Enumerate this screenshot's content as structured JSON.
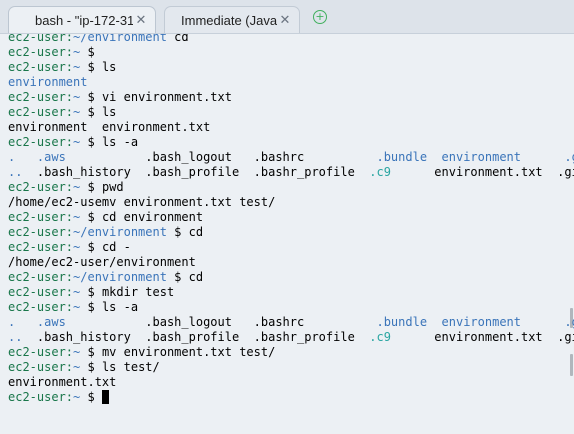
{
  "tabs": [
    {
      "label": "bash - \"ip-172-31",
      "close": "✕"
    },
    {
      "label": "Immediate (Javas",
      "close": "✕"
    }
  ],
  "add_tab_icon": "plus-circle-icon",
  "terminal": {
    "prompt_user": "ec2-user:",
    "home": "~",
    "dir": "~/environment",
    "lines": [
      {
        "type": "prompt",
        "dir": "~/environment",
        "cmd": "cd"
      },
      {
        "type": "prompt",
        "dir": "~",
        "cmd": "$"
      },
      {
        "type": "prompt",
        "dir": "~",
        "cmd": "$ ls"
      },
      {
        "type": "output",
        "text": "environment"
      },
      {
        "type": "prompt",
        "dir": "~",
        "cmd": "$ vi environment.txt"
      },
      {
        "type": "prompt",
        "dir": "~",
        "cmd": "$ ls"
      },
      {
        "type": "output",
        "text": "environment  environment.txt"
      },
      {
        "type": "prompt",
        "dir": "~",
        "cmd": "$ ls -a"
      },
      {
        "type": "ls",
        "row": 1
      },
      {
        "type": "ls",
        "row": 2
      },
      {
        "type": "prompt",
        "dir": "~",
        "cmd": "$ pwd"
      },
      {
        "type": "output",
        "text": "/home/ec2-usemv environment.txt test/"
      },
      {
        "type": "prompt",
        "dir": "~",
        "cmd": "$ cd environment"
      },
      {
        "type": "prompt",
        "dir": "~/environment",
        "cmd": "$ cd"
      },
      {
        "type": "prompt",
        "dir": "~",
        "cmd": "$ cd -"
      },
      {
        "type": "output",
        "text": "/home/ec2-user/environment"
      },
      {
        "type": "prompt",
        "dir": "~/environment",
        "cmd": "$ cd"
      },
      {
        "type": "prompt",
        "dir": "~",
        "cmd": "$ mkdir test"
      },
      {
        "type": "prompt",
        "dir": "~",
        "cmd": "$ ls -a"
      },
      {
        "type": "ls",
        "row": 1
      },
      {
        "type": "ls",
        "row": 3
      },
      {
        "type": "prompt",
        "dir": "~",
        "cmd": "$ mv environment.txt test/"
      },
      {
        "type": "prompt",
        "dir": "~",
        "cmd": "$ ls test/"
      },
      {
        "type": "output",
        "text": "environment.txt"
      },
      {
        "type": "prompt",
        "dir": "~",
        "cmd": "$ ",
        "cursor": true
      }
    ],
    "ls_rows": {
      "1": [
        {
          "t": ".   ",
          "c": "b"
        },
        {
          "t": ".aws           ",
          "c": "b"
        },
        {
          "t": ".bash_logout   ",
          "c": ""
        },
        {
          "t": ".bashrc          ",
          "c": ""
        },
        {
          "t": ".bundle  ",
          "c": "b"
        },
        {
          "t": "environment      ",
          "c": "b"
        },
        {
          "t": ".gi",
          "c": "b"
        }
      ],
      "2": [
        {
          "t": "..  ",
          "c": "b"
        },
        {
          "t": ".bash_history  ",
          "c": ""
        },
        {
          "t": ".bash_profile  ",
          "c": ""
        },
        {
          "t": ".bashr_profile  ",
          "c": ""
        },
        {
          "t": ".c9      ",
          "c": "c"
        },
        {
          "t": "environment.txt  ",
          "c": ""
        },
        {
          "t": ".gi",
          "c": ""
        }
      ],
      "3": [
        {
          "t": "..  ",
          "c": "b"
        },
        {
          "t": ".bash_history  ",
          "c": ""
        },
        {
          "t": ".bash_profile  ",
          "c": ""
        },
        {
          "t": ".bashr_profile  ",
          "c": ""
        },
        {
          "t": ".c9      ",
          "c": "c"
        },
        {
          "t": "environment.txt  ",
          "c": ""
        },
        {
          "t": ".gi",
          "c": ""
        }
      ]
    }
  }
}
